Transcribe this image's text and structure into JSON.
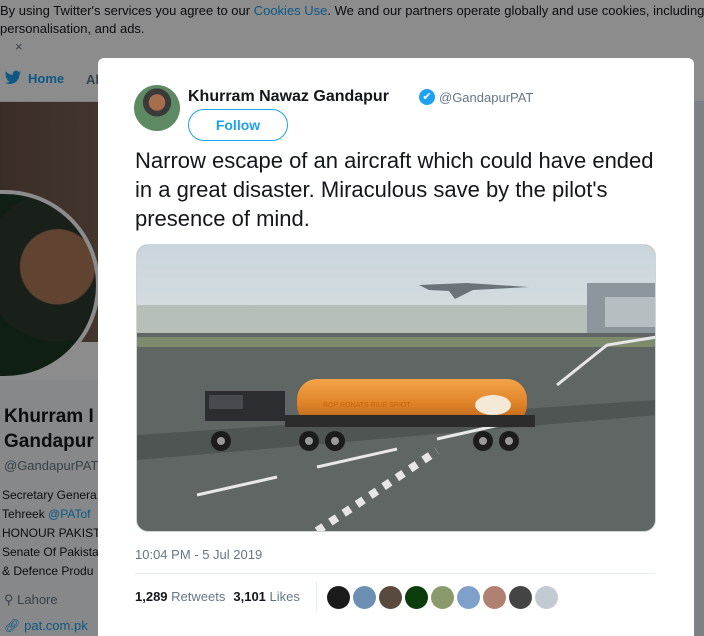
{
  "cookie_banner": {
    "text_before": "By using Twitter's services you agree to our ",
    "link": "Cookies Use",
    "text_after": ". We and our partners operate globally and use cookies, including for analytics,",
    "line2": "personalisation, and ads.",
    "close": "×"
  },
  "nav": {
    "home": "Home",
    "next": "Al"
  },
  "profile": {
    "name_line1": "Khurram I",
    "name_line2": "Gandapur",
    "handle": "@GandapurPAT",
    "bio": [
      "Secretary Genera",
      "Tehreek ",
      "HONOUR PAKIST",
      "Senate Of Pakista",
      "& Defence Produ"
    ],
    "bio_link": "@PATof",
    "location": "Lahore",
    "url": "pat.com.pk"
  },
  "tweet": {
    "name": "Khurram Nawaz Gandapur",
    "verified": "✔",
    "handle": "@GandapurPAT",
    "follow": "Follow",
    "text": "Narrow escape of an aircraft which could have ended in a great disaster. Miraculous save by the pilot's presence of mind.",
    "tanker_text": "ROP RONATS RIUE SRIOT",
    "timestamp": "10:04 PM - 5 Jul 2019",
    "retweets": "1,289",
    "retweets_label": "Retweets",
    "likes": "3,101",
    "likes_label": "Likes"
  },
  "likers": [
    "#1b1b1b",
    "#6d8fb2",
    "#5a4a3e",
    "#0b3d0b",
    "#8a9a6a",
    "#7fa1c9",
    "#b08070",
    "#444444",
    "#c2cad2"
  ]
}
